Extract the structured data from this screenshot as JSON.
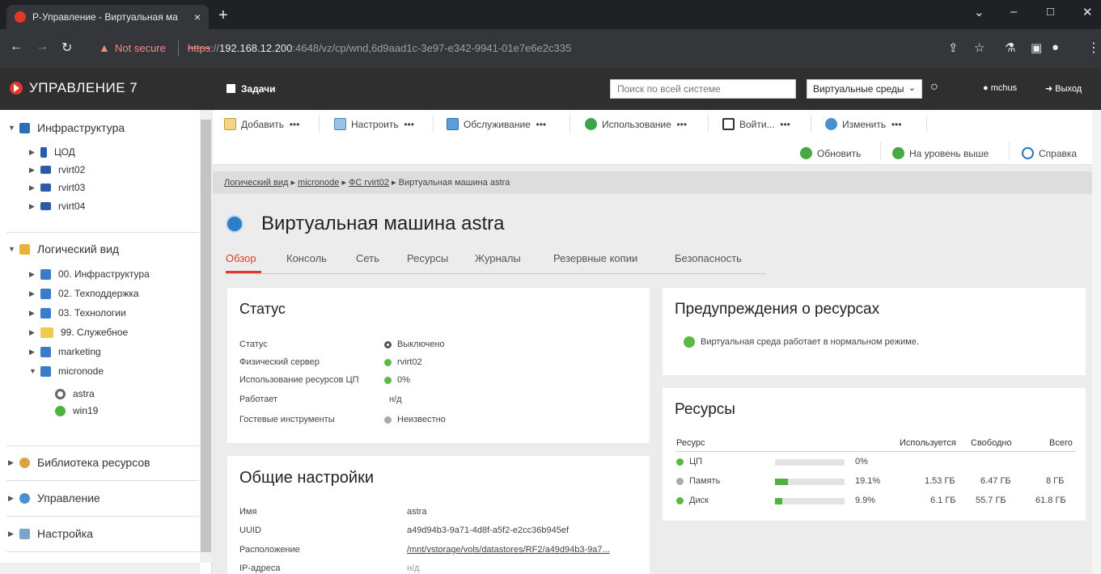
{
  "browser": {
    "tab_title": "Р-Управление - Виртуальная ма",
    "tab_close": "×",
    "newtab": "+",
    "not_secure": "Not secure",
    "url_scheme": "https",
    "url_sep": "://",
    "url_host": "192.168.12.200",
    "url_rest": ":4648/vz/cp/wnd,6d9aad1c-3e97-e342-9941-01e7e6e2c335",
    "win_min": "–",
    "win_max": "□",
    "win_close": "✕",
    "win_menu": "⌄"
  },
  "header": {
    "logo": "УПРАВЛЕНИЕ 7",
    "tasks": "Задачи",
    "search_placeholder": "Поиск по всей системе",
    "env_select": "Виртуальные среды",
    "user": "mchus",
    "logout": "Выход"
  },
  "sidebar": {
    "infra": "Инфраструктура",
    "infra_items": [
      "ЦОД",
      "rvirt02",
      "rvirt03",
      "rvirt04"
    ],
    "logical": "Логический вид",
    "logical_items": [
      "00. Инфраструктура",
      "02. Техподдержка",
      "03. Технологии",
      "99. Служебное",
      "marketing",
      "micronode"
    ],
    "micronode_items": [
      "astra",
      "win19"
    ],
    "library": "Библиотека ресурсов",
    "management": "Управление",
    "settings": "Настройка"
  },
  "toolbar": {
    "add": "Добавить",
    "configure": "Настроить",
    "service": "Обслуживание",
    "usage": "Использование",
    "login": "Войти...",
    "change": "Изменить",
    "more": "•••",
    "refresh": "Обновить",
    "up": "На уровень выше",
    "help": "Справка"
  },
  "breadcrumb": [
    "Логический вид",
    "micronode",
    "ФС rvirt02",
    "Виртуальная машина astra"
  ],
  "page": {
    "title": "Виртуальная машина astra",
    "tabs": [
      "Обзор",
      "Консоль",
      "Сеть",
      "Ресурсы",
      "Журналы",
      "Резервные копии",
      "Безопасность"
    ]
  },
  "status": {
    "title": "Статус",
    "rows": [
      {
        "label": "Статус",
        "value": "Выключено"
      },
      {
        "label": "Физический сервер",
        "value": "rvirt02"
      },
      {
        "label": "Использование ресурсов ЦП",
        "value": "0%"
      },
      {
        "label": "Работает",
        "value": "н/д"
      },
      {
        "label": "Гостевые инструменты",
        "value": "Неизвестно"
      }
    ]
  },
  "general": {
    "title": "Общие настройки",
    "rows": [
      {
        "label": "Имя",
        "value": "astra"
      },
      {
        "label": "UUID",
        "value": "a49d94b3-9a71-4d8f-a5f2-e2cc36b945ef"
      },
      {
        "label": "Расположение",
        "value": "/mnt/vstorage/vols/datastores/RF2/a49d94b3-9a7..."
      },
      {
        "label": "IP-адреса",
        "value": "н/д"
      }
    ]
  },
  "warnings": {
    "title": "Предупреждения о ресурсах",
    "message": "Виртуальная среда работает в нормальном режиме."
  },
  "resources": {
    "title": "Ресурсы",
    "headers": {
      "resource": "Ресурс",
      "used": "Используется",
      "free": "Свободно",
      "total": "Всего"
    },
    "rows": [
      {
        "name": "ЦП",
        "percent_text": "0%",
        "percent": 0,
        "used": "",
        "free": "",
        "total": ""
      },
      {
        "name": "Память",
        "percent_text": "19.1%",
        "percent": 19.1,
        "used": "1.53 ГБ",
        "free": "6.47 ГБ",
        "total": "8 ГБ"
      },
      {
        "name": "Диск",
        "percent_text": "9.9%",
        "percent": 9.9,
        "used": "6.1 ГБ",
        "free": "55.7 ГБ",
        "total": "61.8 ГБ"
      }
    ]
  },
  "colors": {
    "accent": "#e0382b",
    "ok": "#5bb843",
    "header_bg": "#2f2f2f"
  }
}
